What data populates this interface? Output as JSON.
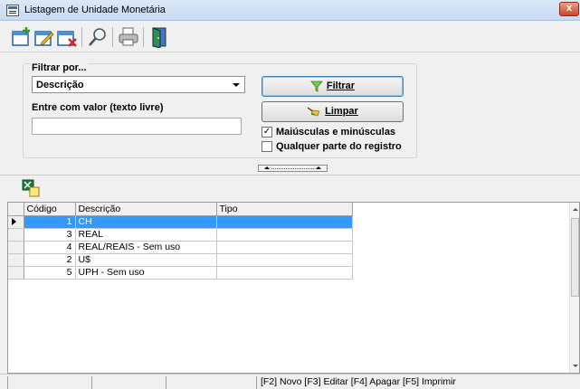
{
  "window": {
    "title": "Listagem de Unidade Monetária",
    "close_label": "x"
  },
  "filter": {
    "group_label": "Filtrar por...",
    "field_selected": "Descrição",
    "value_label": "Entre com valor (texto livre)",
    "value": "",
    "filter_button": "Filtrar",
    "clear_button": "Limpar",
    "case_sensitive_label": "Maiúsculas e minúsculas",
    "case_sensitive_checked": true,
    "any_part_label": "Qualquer parte do registro",
    "any_part_checked": false
  },
  "table": {
    "columns": [
      "Código",
      "Descrição",
      "Tipo"
    ],
    "rows": [
      {
        "codigo": "1",
        "descricao": "CH",
        "tipo": ""
      },
      {
        "codigo": "3",
        "descricao": "REAL",
        "tipo": ""
      },
      {
        "codigo": "4",
        "descricao": "REAL/REAIS - Sem uso",
        "tipo": ""
      },
      {
        "codigo": "2",
        "descricao": "U$",
        "tipo": ""
      },
      {
        "codigo": "5",
        "descricao": "UPH - Sem uso",
        "tipo": ""
      }
    ],
    "selected_row": 0
  },
  "status": {
    "shortcuts": "[F2] Novo [F3] Editar [F4] Apagar [F5] Imprimir"
  },
  "colors": {
    "selection": "#3399ff",
    "accent": "#3c7fb1"
  }
}
